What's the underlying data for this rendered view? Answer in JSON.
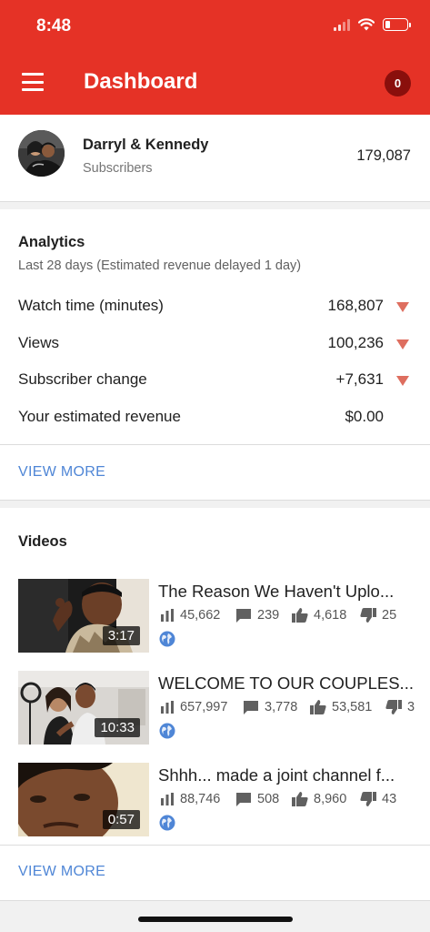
{
  "status_bar": {
    "time": "8:48"
  },
  "header": {
    "title": "Dashboard",
    "notification_count": "0"
  },
  "channel": {
    "name": "Darryl & Kennedy",
    "subscribers_label": "Subscribers",
    "subscriber_count": "179,087"
  },
  "analytics": {
    "title": "Analytics",
    "subtitle": "Last 28 days (Estimated revenue delayed 1 day)",
    "metrics": [
      {
        "label": "Watch time (minutes)",
        "value": "168,807",
        "trend": "down"
      },
      {
        "label": "Views",
        "value": "100,236",
        "trend": "down"
      },
      {
        "label": "Subscriber change",
        "value": "+7,631",
        "trend": "down"
      },
      {
        "label": "Your estimated revenue",
        "value": "$0.00",
        "trend": "none"
      }
    ],
    "view_more": "VIEW MORE"
  },
  "videos": {
    "title": "Videos",
    "items": [
      {
        "title": "The Reason We Haven't Uplo...",
        "duration": "3:17",
        "views": "45,662",
        "comments": "239",
        "likes": "4,618",
        "dislikes": "25"
      },
      {
        "title": "WELCOME TO OUR COUPLES...",
        "duration": "10:33",
        "views": "657,997",
        "comments": "3,778",
        "likes": "53,581",
        "dislikes": "3"
      },
      {
        "title": "Shhh... made a joint channel f...",
        "duration": "0:57",
        "views": "88,746",
        "comments": "508",
        "likes": "8,960",
        "dislikes": "43"
      }
    ],
    "view_more": "VIEW MORE"
  },
  "colors": {
    "header_bg": "#e53226",
    "badge_bg": "#8a0f0c",
    "link": "#4f86d6",
    "trend_down": "#de6e5f",
    "globe": "#4f86d6"
  }
}
